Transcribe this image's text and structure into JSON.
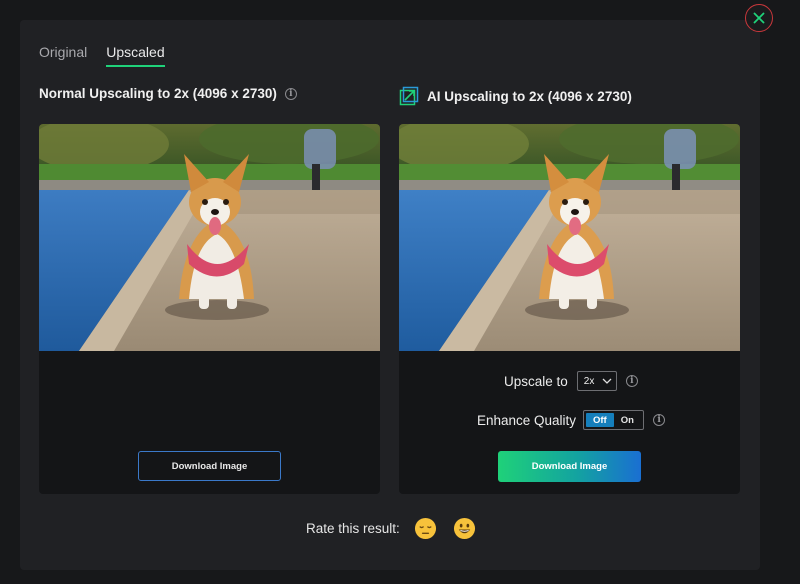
{
  "tabs": [
    {
      "label": "Original",
      "active": false
    },
    {
      "label": "Upscaled",
      "active": true
    }
  ],
  "left_panel": {
    "title": "Normal Upscaling to 2x (4096 x 2730)",
    "info_glyph": "i",
    "download_label": "Download Image"
  },
  "right_panel": {
    "title": "AI Upscaling to 2x (4096 x 2730)",
    "upscale_label": "Upscale to",
    "upscale_value": "2x",
    "info_glyph": "i",
    "enhance_label": "Enhance Quality",
    "toggle_off": "Off",
    "toggle_on": "On",
    "toggle_selected": "Off",
    "download_label": "Download Image"
  },
  "rating": {
    "label": "Rate this result:",
    "icons": [
      "unamused-face-icon",
      "grinning-face-icon"
    ]
  },
  "colors": {
    "accent_green": "#1fd27a",
    "accent_blue": "#1a6fd2",
    "close_ring": "#c9373b",
    "toggle_active": "#157fbc"
  }
}
